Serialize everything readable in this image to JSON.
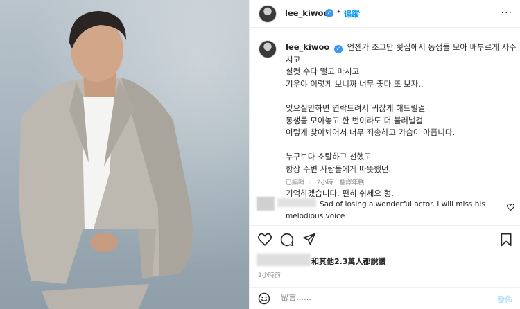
{
  "photo": {
    "alt_icon": "person-photo"
  },
  "header": {
    "username": "lee_kiwoo",
    "verified": "✓",
    "separator": "•",
    "follow_label": "追蹤",
    "more_label": "···"
  },
  "caption": {
    "username": "lee_kiwoo",
    "lines": [
      "언젠가 조그만 횟집에서 동생들 모아 배부르게 사주",
      "시고",
      "실컷 수다 떨고 마시고",
      "기우야 이렇게 보니까 너무 좋다 또 보자..",
      "",
      "잊으실만하면 연락드려서 귀찮게 해드릴걸",
      "동생들 모아놓고 한 번이라도 더 불러낼걸",
      "이렇게 찾아뵈어서 너무 죄송하고 가슴이 아픕니다.",
      "",
      "누구보다 소탈하고 선했고",
      "항상 주변 사람들에게 따뜻했던.",
      "",
      "기억하겠습니다. 편히 쉬세요 형."
    ],
    "meta": {
      "edited": "已編輯",
      "sep": "·",
      "ago": "2小時",
      "translate": "翻譯年糕"
    }
  },
  "comment": {
    "text_line1": "Sad of losing a wonderful actor. I will miss his",
    "text_line2": "melodious voice"
  },
  "likes": {
    "text": "和其他2.3萬人都說讚"
  },
  "time_ago": "2小時前",
  "comment_box": {
    "placeholder": "留言……",
    "post_label": "發佈"
  },
  "colors": {
    "accent": "#0095f6",
    "verified": "#3897f0",
    "meta": "#8e8e8e"
  },
  "icons": [
    "more-icon",
    "heart-icon",
    "comment-icon",
    "share-icon",
    "bookmark-icon",
    "smile-icon",
    "verified-icon"
  ]
}
